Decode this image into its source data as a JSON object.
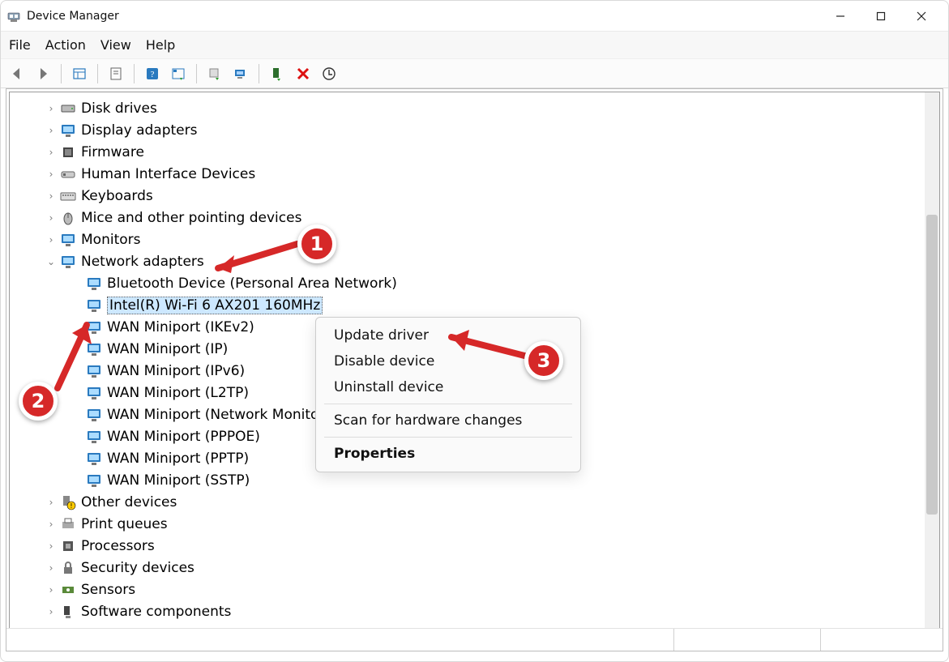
{
  "window": {
    "title": "Device Manager"
  },
  "menu": {
    "file": "File",
    "action": "Action",
    "view": "View",
    "help": "Help"
  },
  "tree": {
    "categories": [
      {
        "key": "disk",
        "label": "Disk drives",
        "icon": "drive"
      },
      {
        "key": "display",
        "label": "Display adapters",
        "icon": "monitor"
      },
      {
        "key": "firmware",
        "label": "Firmware",
        "icon": "chip"
      },
      {
        "key": "hid",
        "label": "Human Interface Devices",
        "icon": "hid"
      },
      {
        "key": "keyboard",
        "label": "Keyboards",
        "icon": "keyboard"
      },
      {
        "key": "mouse",
        "label": "Mice and other pointing devices",
        "icon": "mouse"
      },
      {
        "key": "monitors",
        "label": "Monitors",
        "icon": "monitor"
      },
      {
        "key": "network",
        "label": "Network adapters",
        "icon": "monitor",
        "expanded": true
      },
      {
        "key": "other",
        "label": "Other devices",
        "icon": "warn"
      },
      {
        "key": "print",
        "label": "Print queues",
        "icon": "printer"
      },
      {
        "key": "cpu",
        "label": "Processors",
        "icon": "cpu"
      },
      {
        "key": "security",
        "label": "Security devices",
        "icon": "lock"
      },
      {
        "key": "sensors",
        "label": "Sensors",
        "icon": "sensor"
      },
      {
        "key": "softcomp",
        "label": "Software components",
        "icon": "comp"
      }
    ],
    "network_children": [
      {
        "label": "Bluetooth Device (Personal Area Network)",
        "selected": false
      },
      {
        "label": "Intel(R) Wi-Fi 6 AX201 160MHz",
        "selected": true
      },
      {
        "label": "WAN Miniport (IKEv2)",
        "selected": false
      },
      {
        "label": "WAN Miniport (IP)",
        "selected": false
      },
      {
        "label": "WAN Miniport (IPv6)",
        "selected": false
      },
      {
        "label": "WAN Miniport (L2TP)",
        "selected": false
      },
      {
        "label": "WAN Miniport (Network Monitor)",
        "selected": false
      },
      {
        "label": "WAN Miniport (PPPOE)",
        "selected": false
      },
      {
        "label": "WAN Miniport (PPTP)",
        "selected": false
      },
      {
        "label": "WAN Miniport (SSTP)",
        "selected": false
      }
    ]
  },
  "context_menu": {
    "update": "Update driver",
    "disable": "Disable device",
    "uninstall": "Uninstall device",
    "scan": "Scan for hardware changes",
    "properties": "Properties"
  },
  "annotations": {
    "m1": "1",
    "m2": "2",
    "m3": "3"
  }
}
